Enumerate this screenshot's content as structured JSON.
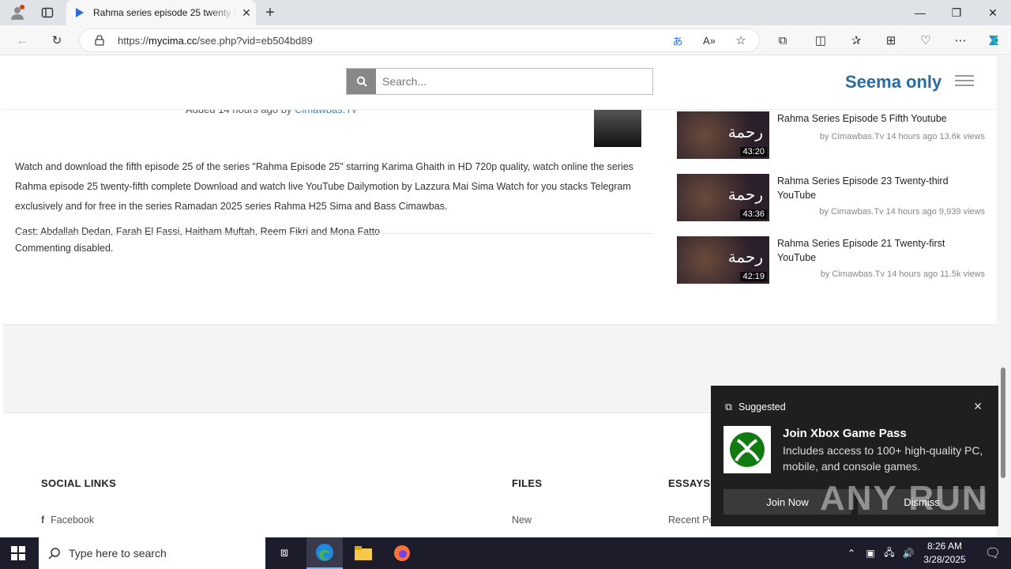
{
  "browser": {
    "tab_title": "Rahma series episode 25 twenty f",
    "url_prefix": "https://",
    "url_domain": "mycima.cc",
    "url_path": "/see.php?vid=eb504bd89"
  },
  "header": {
    "search_placeholder": "Search...",
    "logo": "Seema only"
  },
  "video": {
    "added_prefix": "Added 14 hours ago by ",
    "added_by": "Cimawbas.Tv",
    "description": "Watch and download the fifth episode 25 of the series \"Rahma Episode 25\" starring Karima Ghaith in HD 720p quality, watch online the series Rahma episode 25 twenty-fifth complete Download and watch live YouTube Dailymotion by Lazzura Mai Sima Watch for you stacks Telegram exclusively and for free in the series Ramadan 2025 series Rahma H25 Sima and Bass Cimawbas.",
    "cast": "Cast: Abdallah Dedan, Farah El Fassi, Haitham Muftah, Reem Fikri and Mona Fatto",
    "comments": "Commenting disabled."
  },
  "sidebar": {
    "videos": [
      {
        "title": "Rahma Series Episode 5 Fifth Youtube",
        "meta": "by Cimawbas.Tv 14 hours ago 13.6k views",
        "duration": "43:20",
        "thumb_text": "رحمة"
      },
      {
        "title": "Rahma Series Episode 23 Twenty-third YouTube",
        "meta": "by Cimawbas.Tv 14 hours ago 9,939 views",
        "duration": "43:36",
        "thumb_text": "رحمة"
      },
      {
        "title": "Rahma Series Episode 21 Twenty-first YouTube",
        "meta": "by Cimawbas.Tv 14 hours ago 11.5k views",
        "duration": "42:19",
        "thumb_text": "رحمة"
      }
    ]
  },
  "footer": {
    "social_title": "SOCIAL LINKS",
    "social_link": "Facebook",
    "files_title": "FILES",
    "files_link": "New",
    "essays_title": "ESSAYS",
    "essays_link": "Recent Po"
  },
  "toast": {
    "label": "Suggested",
    "title": "Join Xbox Game Pass",
    "body": "Includes access to 100+ high-quality PC, mobile, and console games.",
    "join": "Join Now",
    "dismiss": "Dismiss",
    "watermark": "ANY RUN"
  },
  "taskbar": {
    "search_placeholder": "Type here to search",
    "time": "8:26 AM",
    "date": "3/28/2025"
  }
}
